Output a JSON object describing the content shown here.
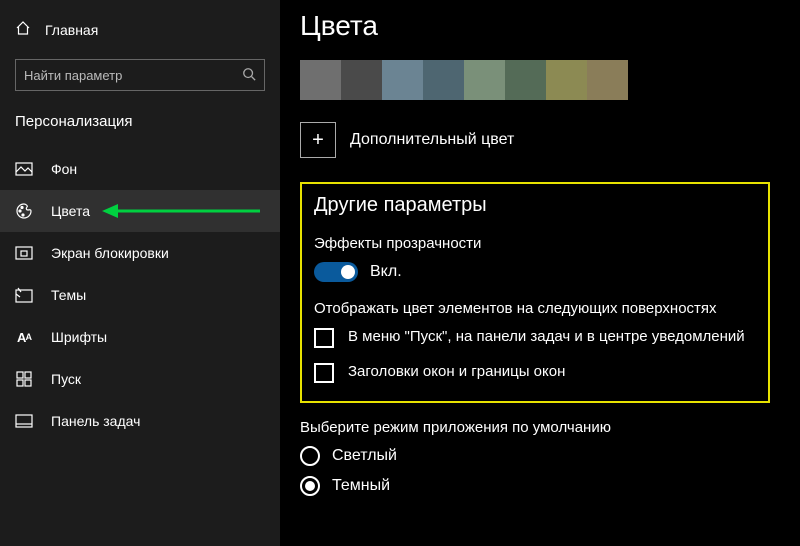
{
  "sidebar": {
    "home": "Главная",
    "search_placeholder": "Найти параметр",
    "category": "Персонализация",
    "items": [
      {
        "label": "Фон"
      },
      {
        "label": "Цвета"
      },
      {
        "label": "Экран блокировки"
      },
      {
        "label": "Темы"
      },
      {
        "label": "Шрифты"
      },
      {
        "label": "Пуск"
      },
      {
        "label": "Панель задач"
      }
    ]
  },
  "main": {
    "title": "Цвета",
    "swatches": [
      "#6f6f6f",
      "#4a4a4a",
      "#6b8493",
      "#4e6671",
      "#7a9079",
      "#546b57",
      "#8c8a53",
      "#8a7d59"
    ],
    "add_custom_color": "Дополнительный цвет",
    "other_section": "Другие параметры",
    "transparency_label": "Эффекты прозрачности",
    "transparency_state": "Вкл.",
    "accent_surfaces_label": "Отображать цвет элементов на следующих поверхностях",
    "checkboxes": [
      "В меню \"Пуск\", на панели задач и в центре уведомлений",
      "Заголовки окон и границы окон"
    ],
    "app_mode_label": "Выберите режим приложения по умолчанию",
    "radios": [
      {
        "label": "Светлый",
        "checked": false
      },
      {
        "label": "Темный",
        "checked": true
      }
    ]
  }
}
